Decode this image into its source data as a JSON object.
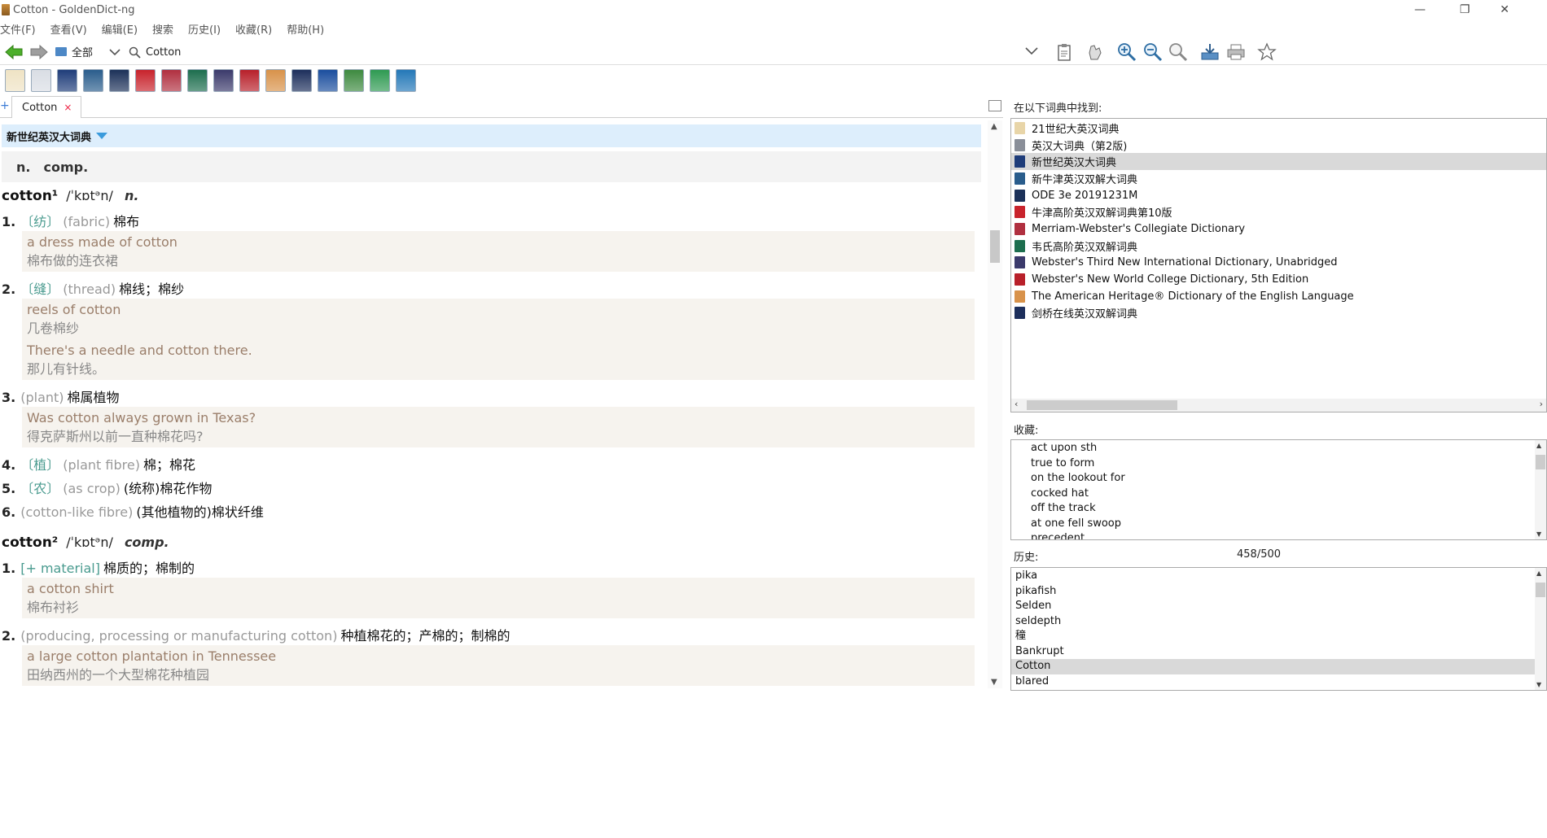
{
  "window": {
    "title": "Cotton - GoldenDict-ng"
  },
  "menu": [
    "文件(F)",
    "查看(V)",
    "编辑(E)",
    "搜索",
    "历史(I)",
    "收藏(R)",
    "帮助(H)"
  ],
  "toolbar": {
    "group": "全部",
    "search_value": "Cotton"
  },
  "tab": {
    "label": "Cotton",
    "close": "×"
  },
  "article": {
    "dictionary": "新世纪英汉大词典",
    "pos_summary": [
      "n.",
      "comp."
    ],
    "entries": [
      {
        "headword": "cotton¹",
        "pron": "/ˈkɒtᵊn/",
        "pos": "n.",
        "senses": [
          {
            "num": "1.",
            "label": "〔纺〕",
            "gloss": "(fabric)",
            "def": "棉布",
            "examples": [
              {
                "en": "a dress made of cotton",
                "zh": "棉布做的连衣裙"
              }
            ]
          },
          {
            "num": "2.",
            "label": "〔缝〕",
            "gloss": "(thread)",
            "def": "棉线；棉纱",
            "examples": [
              {
                "en": "reels of cotton",
                "zh": "几卷棉纱"
              },
              {
                "en": "There's a needle and cotton there.",
                "zh": "那儿有针线。"
              }
            ]
          },
          {
            "num": "3.",
            "label": "",
            "gloss": "(plant)",
            "def": "棉属植物",
            "examples": [
              {
                "en": "Was cotton always grown in Texas?",
                "zh": "得克萨斯州以前一直种棉花吗?"
              }
            ]
          },
          {
            "num": "4.",
            "label": "〔植〕",
            "gloss": "(plant fibre)",
            "def": "棉；棉花",
            "examples": []
          },
          {
            "num": "5.",
            "label": "〔农〕",
            "gloss": "(as crop)",
            "def": "(统称)棉花作物",
            "examples": []
          },
          {
            "num": "6.",
            "label": "",
            "gloss": "(cotton-like fibre)",
            "def": "(其他植物的)棉状纤维",
            "examples": []
          }
        ]
      },
      {
        "headword": "cotton²",
        "pron": "/ˈkɒtᵊn/",
        "pos": "comp.",
        "senses": [
          {
            "num": "1.",
            "label": "[+ material]",
            "gloss": "",
            "def": "棉质的；棉制的",
            "examples": [
              {
                "en": "a cotton shirt",
                "zh": "棉布衬衫"
              }
            ]
          },
          {
            "num": "2.",
            "label": "",
            "gloss": "(producing, processing or manufacturing cotton)",
            "def": "种植棉花的；产棉的；制棉的",
            "examples": [
              {
                "en": "a large cotton plantation in Tennessee",
                "zh": "田纳西州的一个大型棉花种植园"
              }
            ]
          }
        ]
      }
    ]
  },
  "found_in": {
    "title": "在以下词典中找到:",
    "items": [
      {
        "name": "21世纪大英汉词典",
        "color": "#e8d5a8",
        "selected": false
      },
      {
        "name": "英汉大词典（第2版)",
        "color": "#8a8f99",
        "selected": false
      },
      {
        "name": "新世纪英汉大词典",
        "color": "#1f3d7a",
        "selected": true
      },
      {
        "name": "新牛津英汉双解大词典",
        "color": "#2a5d8c",
        "selected": false
      },
      {
        "name": "ODE 3e 20191231M",
        "color": "#1c3159",
        "selected": false
      },
      {
        "name": "牛津高阶英汉双解词典第10版",
        "color": "#c8232c",
        "selected": false
      },
      {
        "name": "Merriam-Webster's Collegiate Dictionary",
        "color": "#b03040",
        "selected": false
      },
      {
        "name": "韦氏高阶英汉双解词典",
        "color": "#1d6e4e",
        "selected": false
      },
      {
        "name": "Webster's Third New International Dictionary, Unabridged",
        "color": "#3b3a6b",
        "selected": false
      },
      {
        "name": "Webster's New World College Dictionary, 5th Edition",
        "color": "#b8202a",
        "selected": false
      },
      {
        "name": "The American Heritage® Dictionary of the English Language",
        "color": "#d8924a",
        "selected": false
      },
      {
        "name": "剑桥在线英汉双解词典",
        "color": "#1d2f5c",
        "selected": false
      }
    ]
  },
  "favorites": {
    "title": "收藏:",
    "items": [
      "act upon sth",
      "true to form",
      "on the lookout for",
      "cocked hat",
      "off the track",
      "at one fell swoop",
      "precedent"
    ]
  },
  "history": {
    "title": "历史:",
    "count": "458/500",
    "items": [
      "pika",
      "pikafish",
      "Selden",
      "seldepth",
      "穜",
      "Bankrupt",
      "Cotton",
      "blared"
    ],
    "selected_index": 6
  },
  "dict_toolbar_colors": [
    "#efe3c4",
    "#d9dde4",
    "#1f3d7a",
    "#2a5d8c",
    "#1c3159",
    "#c8232c",
    "#b03040",
    "#1d6e4e",
    "#3b3a6b",
    "#b8202a",
    "#d8924a",
    "#1d2f5c",
    "#1b4e9e",
    "#3e8a40",
    "#2f9a52",
    "#2478b8"
  ]
}
